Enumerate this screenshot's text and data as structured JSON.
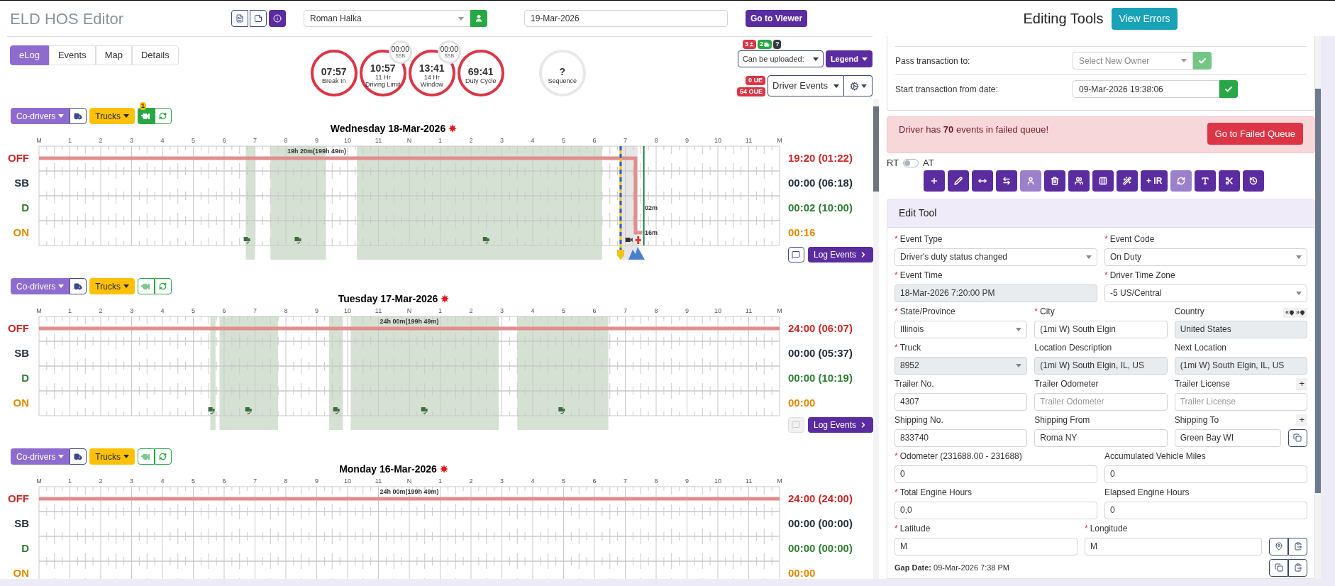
{
  "header": {
    "title": "ELD HOS Editor",
    "driver": "Roman Halka",
    "date": "19-Mar-2026",
    "viewer_button": "Go to Viewer"
  },
  "tabs": [
    {
      "label": "eLog",
      "selected": true
    },
    {
      "label": "Events",
      "selected": false
    },
    {
      "label": "Map",
      "selected": false
    },
    {
      "label": "Details",
      "selected": false
    }
  ],
  "timers": [
    {
      "value": "07:57",
      "lines": [
        "Break In"
      ],
      "alert": true
    },
    {
      "value": "10:57",
      "lines": [
        "11 Hr",
        "Driving Limit"
      ],
      "alert": true,
      "sub": {
        "value": "00:00",
        "label": "SSB"
      }
    },
    {
      "value": "13:41",
      "lines": [
        "14 Hr",
        "Window"
      ],
      "alert": true,
      "sub": {
        "value": "00:00",
        "label": "SSB"
      }
    },
    {
      "value": "69:41",
      "lines": [
        "Duty Cycle"
      ],
      "alert": true
    },
    {
      "value": "?",
      "lines": [
        "Sequence"
      ],
      "alert": false
    }
  ],
  "status_badges": [
    {
      "text": "3",
      "kind": "driver",
      "color": "#dc3545"
    },
    {
      "text": "2",
      "kind": "truck",
      "color": "#28a745"
    },
    {
      "text": "?",
      "kind": "plain",
      "color": "#343a40"
    }
  ],
  "upload_select": "Can be uploaded:",
  "legend_button": "Legend",
  "event_badges": [
    "0 UE",
    "54 OUE"
  ],
  "events_select": "Driver Events",
  "days": [
    {
      "codrivers": "Co-drivers",
      "trucks": "Trucks",
      "engine_active": true,
      "engine_badge": "1",
      "title": "Wednesday 18-Mar-2026",
      "hour_labels": [
        "M",
        "1",
        "2",
        "3",
        "4",
        "5",
        "6",
        "7",
        "8",
        "9",
        "10",
        "11",
        "N",
        "1",
        "2",
        "3",
        "4",
        "5",
        "6",
        "7",
        "8",
        "9",
        "10",
        "11",
        "M"
      ],
      "rows": [
        {
          "label": "OFF",
          "total": "19:20 (01:22)"
        },
        {
          "label": "SB",
          "total": "00:00 (06:18)"
        },
        {
          "label": "D",
          "total": "00:02 (10:00)"
        },
        {
          "label": "ON",
          "total": "00:16"
        }
      ],
      "chart_labels": [
        "19h 20m(199h 49m)",
        "02m",
        "16m"
      ],
      "chat_enabled": true,
      "log_button": "Log Events"
    },
    {
      "codrivers": "Co-drivers",
      "trucks": "Trucks",
      "engine_active": false,
      "title": "Tuesday 17-Mar-2026",
      "hour_labels": [
        "M",
        "1",
        "2",
        "3",
        "4",
        "5",
        "6",
        "7",
        "8",
        "9",
        "10",
        "11",
        "N",
        "1",
        "2",
        "3",
        "4",
        "5",
        "6",
        "7",
        "8",
        "9",
        "10",
        "11",
        "M"
      ],
      "rows": [
        {
          "label": "OFF",
          "total": "24:00 (06:07)"
        },
        {
          "label": "SB",
          "total": "00:00 (05:37)"
        },
        {
          "label": "D",
          "total": "00:00 (10:19)"
        },
        {
          "label": "ON",
          "total": "00:00"
        }
      ],
      "chart_labels": [
        "24h 00m(199h 49m)"
      ],
      "chat_enabled": false,
      "log_button": "Log Events"
    },
    {
      "codrivers": "Co-drivers",
      "trucks": "Trucks",
      "engine_active": false,
      "title": "Monday 16-Mar-2026",
      "hour_labels": [
        "M",
        "1",
        "2",
        "3",
        "4",
        "5",
        "6",
        "7",
        "8",
        "9",
        "10",
        "11",
        "N",
        "1",
        "2",
        "3",
        "4",
        "5",
        "6",
        "7",
        "8",
        "9",
        "10",
        "11",
        "M"
      ],
      "rows": [
        {
          "label": "OFF",
          "total": "24:00 (24:00)"
        },
        {
          "label": "SB",
          "total": "00:00 (00:00)"
        },
        {
          "label": "D",
          "total": "00:00 (00:00)"
        },
        {
          "label": "ON",
          "total": "00:00"
        }
      ],
      "chart_labels": [
        "24h 00m(199h 49m)"
      ]
    }
  ],
  "editing": {
    "title": "Editing Tools",
    "errors_button": "View Errors",
    "pass_label": "Pass transaction to:",
    "owner_placeholder": "Select New Owner",
    "start_label": "Start transaction from date:",
    "start_value": "09-Mar-2026 19:38:06",
    "alert": {
      "text": "Driver has **70** events in failed queue!",
      "button": "Go to Failed Queue"
    },
    "switch": {
      "left": "RT",
      "right": "AT",
      "on": false
    },
    "tools": [
      {
        "kind": "icon",
        "disabled": false
      },
      {
        "kind": "icon",
        "disabled": false
      },
      {
        "kind": "icon",
        "disabled": false
      },
      {
        "kind": "icon",
        "disabled": false
      },
      {
        "kind": "icon",
        "disabled": true
      },
      {
        "kind": "icon",
        "disabled": false
      },
      {
        "kind": "icon",
        "disabled": false
      },
      {
        "kind": "icon",
        "disabled": false
      },
      {
        "kind": "icon",
        "disabled": false
      },
      {
        "kind": "text",
        "label": "+ IR",
        "disabled": false
      },
      {
        "kind": "icon",
        "disabled": true
      },
      {
        "kind": "icon",
        "disabled": false
      },
      {
        "kind": "icon",
        "disabled": false
      },
      {
        "kind": "icon",
        "disabled": false
      }
    ],
    "edit_tool": {
      "title": "Edit Tool",
      "rows": [
        {
          "kind": "two",
          "fields": [
            {
              "label": "Event Type",
              "mark": "*",
              "kind": "select",
              "value": "Driver's duty status changed"
            },
            {
              "label": "Event Code",
              "mark": "*",
              "kind": "select",
              "value": "On Duty"
            }
          ]
        },
        {
          "kind": "two",
          "fields": [
            {
              "label": "Event Time",
              "mark": "*",
              "kind": "readonly",
              "value": "18-Mar-2026 7:20:00 PM"
            },
            {
              "label": "Driver Time Zone",
              "mark": "*",
              "kind": "select",
              "value": "-5 US/Central"
            }
          ]
        },
        {
          "kind": "three",
          "fields": [
            {
              "label": "State/Province",
              "mark": "*",
              "kind": "select",
              "value": "Illinois"
            },
            {
              "label": "City",
              "mark": "*",
              "kind": "input",
              "value": "(1mi W) South Elgin"
            },
            {
              "label": "Country",
              "kind": "readonly",
              "value": "United States",
              "nav": [
                "«",
                "»"
              ]
            }
          ]
        },
        {
          "kind": "three",
          "fields": [
            {
              "label": "Truck",
              "mark": "*",
              "kind": "readonly-select",
              "value": "8952"
            },
            {
              "label": "Location Description",
              "kind": "readonly",
              "value": "(1mi W) South Elgin, IL, US"
            },
            {
              "label": "Next Location",
              "kind": "readonly",
              "value": "(1mi W) South Elgin, IL, US"
            }
          ]
        },
        {
          "kind": "three",
          "fields": [
            {
              "label": "Trailer No.",
              "kind": "input",
              "value": "4307"
            },
            {
              "label": "Trailer Odometer",
              "kind": "input",
              "placeholder": "Trailer Odometer"
            },
            {
              "label": "Trailer License",
              "kind": "input",
              "placeholder": "Trailer License",
              "add": "+"
            }
          ]
        },
        {
          "kind": "three",
          "fields": [
            {
              "label": "Shipping No.",
              "kind": "input",
              "value": "833740"
            },
            {
              "label": "Shipping From",
              "kind": "input",
              "value": "Roma NY"
            },
            {
              "label": "Shipping To",
              "kind": "input",
              "value": "Green Bay WI",
              "add": "+",
              "actions": [
                {
                  "kind": "copy"
                }
              ]
            }
          ]
        },
        {
          "kind": "two",
          "fields": [
            {
              "label": "Odometer (231688.00 - 231688)",
              "mark": "*",
              "kind": "input",
              "value": "0"
            },
            {
              "label": "Accumulated Vehicle Miles",
              "kind": "input",
              "value": "0"
            }
          ]
        },
        {
          "kind": "two",
          "fields": [
            {
              "label": "Total Engine Hours",
              "mark": "*",
              "kind": "input",
              "value": "0,0"
            },
            {
              "label": "Elapsed Engine Hours",
              "kind": "input",
              "value": "0"
            }
          ]
        },
        {
          "kind": "latlon",
          "fields": [
            {
              "label": "Latitude",
              "mark": "*",
              "kind": "input",
              "value": "M"
            },
            {
              "label": "Longitude",
              "mark": "*",
              "kind": "input",
              "value": "M",
              "actions": [
                {
                  "kind": "pin"
                },
                {
                  "kind": "paste"
                }
              ]
            }
          ]
        }
      ],
      "gap": "**Gap Date:** 09-Mar-2026 7:38 PM",
      "gap_actions": [
        {
          "kind": "copy"
        },
        {
          "kind": "paste"
        }
      ]
    }
  }
}
